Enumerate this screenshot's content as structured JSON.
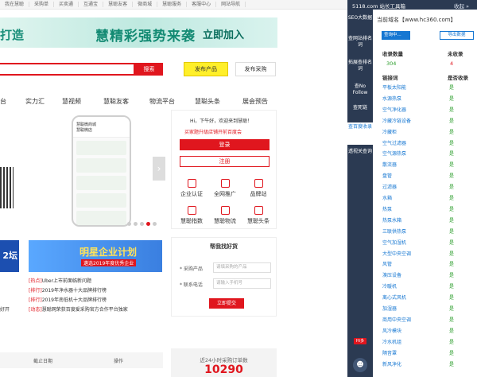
{
  "topbar": [
    "我在慧聪",
    "采购单",
    "买卖通",
    "互通宝",
    "慧聪友客",
    "微商城",
    "慧聪服务",
    "客服中心",
    "网站导航"
  ],
  "banner": {
    "left": "打造",
    "mid": "慧精彩强势来袭",
    "join": "立即加入"
  },
  "search": {
    "button": "搜索",
    "publish": "发布产品",
    "purchase": "发布采购"
  },
  "nav": [
    "台",
    "实力汇",
    "慧视频",
    "慧聪友客",
    "物流平台",
    "慧聪头条",
    "展会预告"
  ],
  "phone": {
    "shop": "慧聪微商城",
    "sub": "慧聪微店"
  },
  "login": {
    "greeting": "Hi，下午好，欢迎来到慧聪！",
    "ad": "买家题升级店铺开前百度会",
    "login_btn": "登录",
    "register_btn": "注册",
    "features": [
      "企业认证",
      "全网推广",
      "品牌站",
      "慧聪指数",
      "慧聪物流",
      "慧聪头条"
    ]
  },
  "forum": "2坛",
  "promo": {
    "title": "明星企业计划",
    "sub": "遴选2019年度优秀企业"
  },
  "news": [
    {
      "tag": "[热点]",
      "text": "Uber上市前面临新问题"
    },
    {
      "tag": "[排行]",
      "text": "2019年净水器十大品牌排行榜"
    },
    {
      "tag": "[排行]",
      "text": "2019年南低机十大品牌排行榜"
    },
    {
      "tag": "[动态]",
      "text": "慧聪网荣获百度爱采购官方合作平台独家"
    }
  ],
  "news_left": [
    "好开"
  ],
  "find": {
    "title": "帮我找好货",
    "product_label": "* 采购产品",
    "product_ph": "请填采购的产品",
    "phone_label": "* 联系电话",
    "phone_ph": "请输入手机号",
    "submit": "立即提交"
  },
  "table": {
    "date": "截止日期",
    "op": "操作"
  },
  "stat": {
    "label": "近24小时采购订单数",
    "value": "10290"
  },
  "toolbar": {
    "name": "5118.com 站长工具箱",
    "collapse": "收起 »"
  },
  "side": [
    "SEO大数据",
    "查网站排名词",
    "拓展查排名词",
    "查No Follow",
    "查死链",
    "查百度收录",
    "透视关查询"
  ],
  "side_badge": "Hi多",
  "panel": {
    "current": "当前域名【www.hc360.com】",
    "query_btn": "查询中...",
    "export_btn": "导出数据",
    "h_count": "收录数量",
    "h_notcount": "未收录",
    "count": "304",
    "notcount": "4",
    "h_link": "链接词",
    "h_status": "是否收录",
    "links": [
      "平板太阳能",
      "水源热泵",
      "空气净化器",
      "冷藏冷链设备",
      "冷藏柜",
      "空气过滤器",
      "空气源热泵",
      "散流器",
      "盘管",
      "过滤器",
      "水箱",
      "热泵",
      "热泵水箱",
      "三联供热泵",
      "空气加湿机",
      "大型中央空调",
      "风管",
      "溴压设备",
      "冷暖机",
      "离心式风机",
      "加湿器",
      "商用中央空调",
      "风冷模块",
      "冷水机组",
      "隔音罩",
      "新风净化"
    ],
    "yes": "是"
  },
  "colors": {
    "red": "#e0161e",
    "blue": "#1677d2",
    "sidebar": "#2b3a52",
    "green": "#2a9d2a"
  }
}
